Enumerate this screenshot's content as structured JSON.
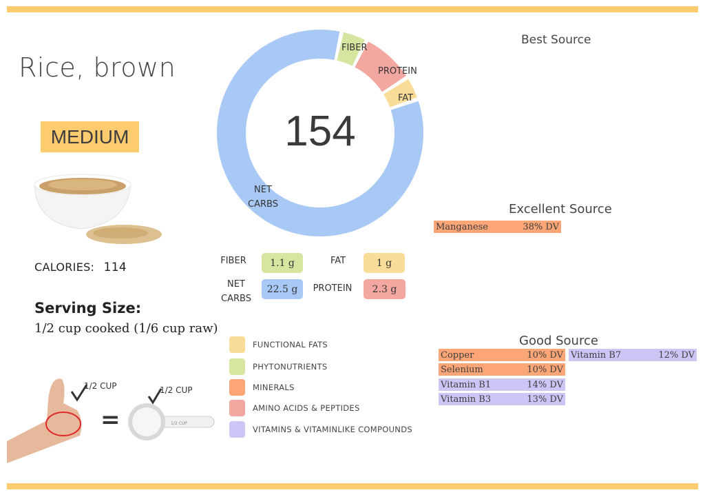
{
  "food": {
    "name": "Rice, brown",
    "glycemic_badge": "MEDIUM",
    "calories_label": "CALORIES:",
    "calories_value": "114",
    "serving_label": "Serving Size:",
    "serving_value": "1/2 cup cooked (1/6 cup raw)",
    "photo_icon": "rice-bowl-photo"
  },
  "illustration": {
    "hand_label": "1/2 CUP",
    "cup_label": "1/2 CUP",
    "cup_handle_text": "1/2 CUP",
    "equals": "="
  },
  "colors": {
    "accent": "#fecb6f",
    "net_carbs": "#a8c8f5",
    "fiber": "#d6e5a0",
    "protein": "#f4a6a1",
    "fat": "#f9dc97",
    "minerals": "#fca577",
    "vitamins": "#cdc5f5",
    "functional_fats": "#f9dc97",
    "phytonutrients": "#d6e5a0",
    "amino_acids": "#f4a6a1"
  },
  "chart_data": {
    "type": "pie",
    "style": "donut",
    "center_label": "154",
    "slices": [
      {
        "name": "FIBER",
        "label": "FIBER",
        "value": 1.1,
        "color": "#d6e5a0"
      },
      {
        "name": "PROTEIN",
        "label": "PROTEIN",
        "value": 2.3,
        "color": "#f4a6a1"
      },
      {
        "name": "FAT",
        "label": "FAT",
        "value": 1.0,
        "color": "#f9dc97"
      },
      {
        "name": "NET CARBS",
        "label": "NET\nCARBS",
        "value": 22.5,
        "color": "#a8c8f5"
      }
    ],
    "units": "g"
  },
  "macros": [
    {
      "label": "FIBER",
      "value": "1.1 g",
      "color": "#d6e5a0"
    },
    {
      "label": "FAT",
      "value": "1 g",
      "color": "#f9dc97"
    },
    {
      "label_line1": "NET",
      "label_line2": "CARBS",
      "value": "22.5 g",
      "color": "#a8c8f5"
    },
    {
      "label": "PROTEIN",
      "value": "2.3 g",
      "color": "#f4a6a1"
    }
  ],
  "legend": [
    {
      "label": "FUNCTIONAL  FATS",
      "color": "#f9dc97"
    },
    {
      "label": "PHYTONUTRIENTS",
      "color": "#d6e5a0"
    },
    {
      "label": "MINERALS",
      "color": "#fca577"
    },
    {
      "label": "AMINO ACIDS & PEPTIDES",
      "color": "#f4a6a1"
    },
    {
      "label": "VITAMINS & VITAMINLIKE COMPOUNDS",
      "color": "#cdc5f5"
    }
  ],
  "sources": {
    "best": {
      "heading": "Best Source",
      "items": []
    },
    "excellent": {
      "heading": "Excellent Source",
      "items": [
        {
          "name": "Manganese",
          "dv": "38% DV",
          "category": "minerals"
        }
      ]
    },
    "good": {
      "heading": "Good Source",
      "items": [
        {
          "name": "Copper",
          "dv": "10% DV",
          "category": "minerals"
        },
        {
          "name": "Selenium",
          "dv": "10% DV",
          "category": "minerals"
        },
        {
          "name": "Vitamin B1",
          "dv": "14% DV",
          "category": "vitamins"
        },
        {
          "name": "Vitamin B3",
          "dv": "13% DV",
          "category": "vitamins"
        },
        {
          "name": "Vitamin B7",
          "dv": "12% DV",
          "category": "vitamins"
        }
      ]
    }
  }
}
